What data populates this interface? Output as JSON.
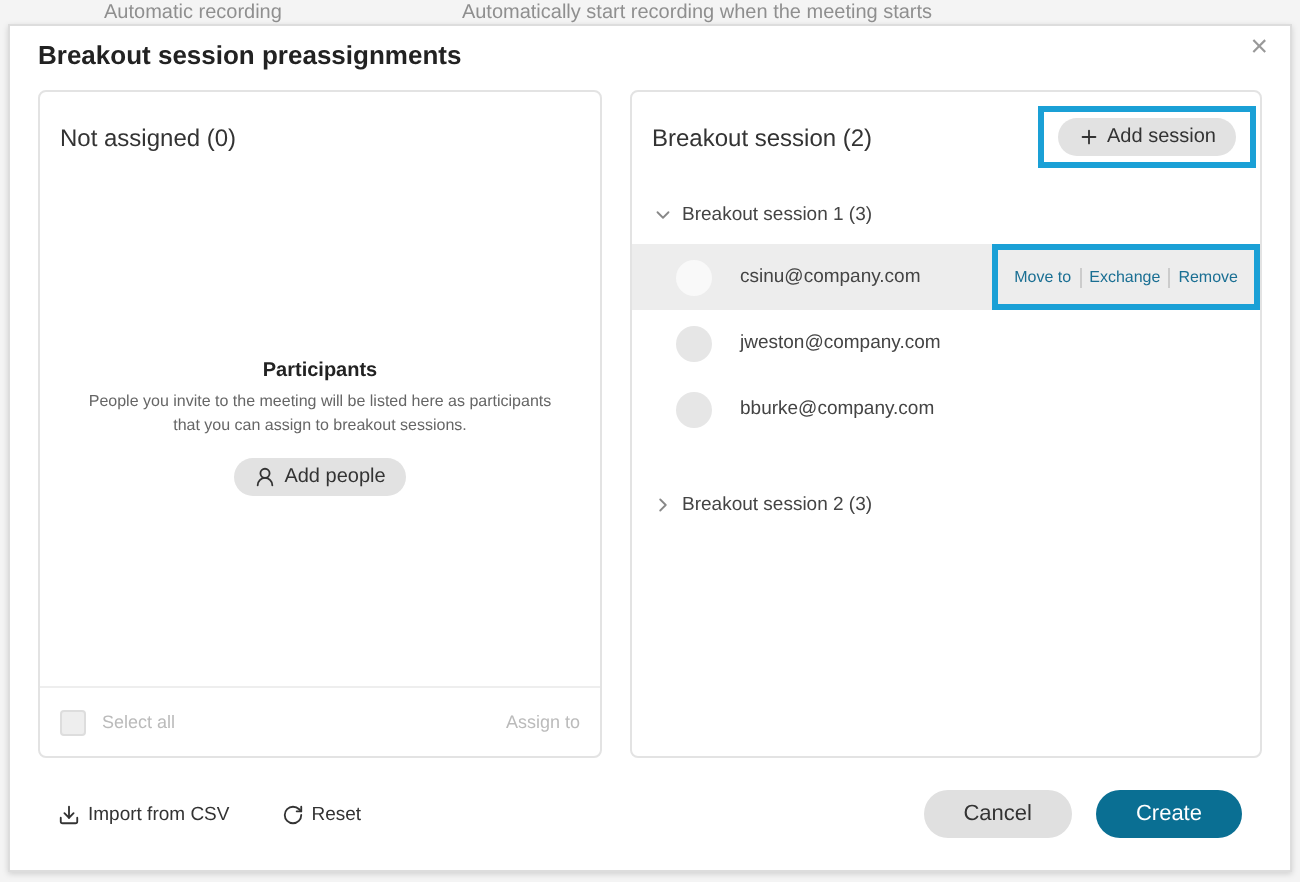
{
  "background": {
    "label": "Automatic recording",
    "description": "Automatically start recording when the meeting starts"
  },
  "dialog": {
    "title": "Breakout session preassignments",
    "close": "×"
  },
  "unassigned": {
    "title": "Not assigned (0)",
    "empty_title": "Participants",
    "empty_text": "People you invite to the meeting will be listed here as participants that you can assign to breakout sessions.",
    "add_button": "Add people",
    "select_all": {
      "label": "Select all",
      "checked": false,
      "disabled": true
    },
    "assign": {
      "label": "Assign to",
      "disabled": true
    }
  },
  "sessions": {
    "title": "Breakout session (2)",
    "add_button": {
      "label": "Add session",
      "highlighted": true
    },
    "items": [
      {
        "name": "Breakout session 1 (3)",
        "expanded": true,
        "members": [
          {
            "email": "csinu@company.com",
            "selected": true,
            "actions": [
              "Move to",
              "Exchange",
              "Remove"
            ],
            "highlighted": true
          },
          {
            "email": "jweston@company.com",
            "selected": false
          },
          {
            "email": "bburke@company.com",
            "selected": false
          }
        ]
      },
      {
        "name": "Breakout session 2 (3)",
        "expanded": false
      }
    ]
  },
  "footer": {
    "import": "Import from CSV",
    "reset": "Reset",
    "cancel": "Cancel",
    "create": "Create"
  }
}
